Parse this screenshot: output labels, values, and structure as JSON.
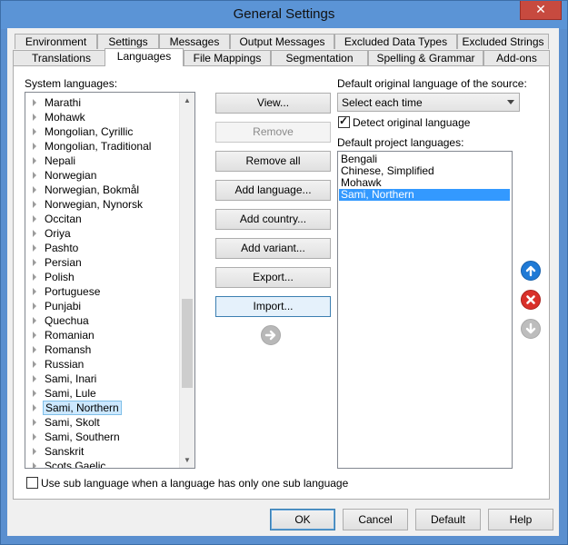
{
  "window": {
    "title": "General Settings",
    "close_glyph": "✕"
  },
  "tabs_row1": [
    "Environment",
    "Settings",
    "Messages",
    "Output Messages",
    "Excluded Data Types",
    "Excluded Strings"
  ],
  "tabs_row2": [
    "Translations",
    "Languages",
    "File Mappings",
    "Segmentation",
    "Spelling & Grammar",
    "Add-ons"
  ],
  "active_tab": "Languages",
  "system_languages": {
    "label": "System languages:",
    "items": [
      "Marathi",
      "Mohawk",
      "Mongolian, Cyrillic",
      "Mongolian, Traditional",
      "Nepali",
      "Norwegian",
      "Norwegian, Bokmål",
      "Norwegian, Nynorsk",
      "Occitan",
      "Oriya",
      "Pashto",
      "Persian",
      "Polish",
      "Portuguese",
      "Punjabi",
      "Quechua",
      "Romanian",
      "Romansh",
      "Russian",
      "Sami, Inari",
      "Sami, Lule",
      "Sami, Northern",
      "Sami, Skolt",
      "Sami, Southern",
      "Sanskrit",
      "Scots Gaelic"
    ],
    "selected": "Sami, Northern"
  },
  "action_buttons": [
    {
      "label": "View...",
      "enabled": true
    },
    {
      "label": "Remove",
      "enabled": false
    },
    {
      "label": "Remove all",
      "enabled": true
    },
    {
      "label": "Add language...",
      "enabled": true
    },
    {
      "label": "Add country...",
      "enabled": true
    },
    {
      "label": "Add variant...",
      "enabled": true
    },
    {
      "label": "Export...",
      "enabled": true
    },
    {
      "label": "Import...",
      "enabled": true
    }
  ],
  "source": {
    "label": "Default original language of the source:",
    "selected": "Select each time",
    "detect_label": "Detect original language",
    "detect_checked": true
  },
  "project_languages": {
    "label": "Default project languages:",
    "items": [
      "Bengali",
      "Chinese, Simplified",
      "Mohawk",
      "Sami, Northern"
    ],
    "selected": "Sami, Northern"
  },
  "icons": {
    "move_up": "arrow-up-icon",
    "delete": "delete-icon",
    "move_down": "arrow-down-icon",
    "add_right": "arrow-right-icon"
  },
  "sub_language": {
    "label": "Use sub language when a language has only one sub language",
    "checked": false
  },
  "footer": {
    "ok": "OK",
    "cancel": "Cancel",
    "default": "Default",
    "help": "Help"
  },
  "colors": {
    "title_bar": "#5b94d6",
    "close": "#c74a3f",
    "up_icon": "#1f7ad6",
    "delete_icon": "#d9302a",
    "disabled_icon": "#bdbdbd",
    "selection": "#3399ff"
  }
}
